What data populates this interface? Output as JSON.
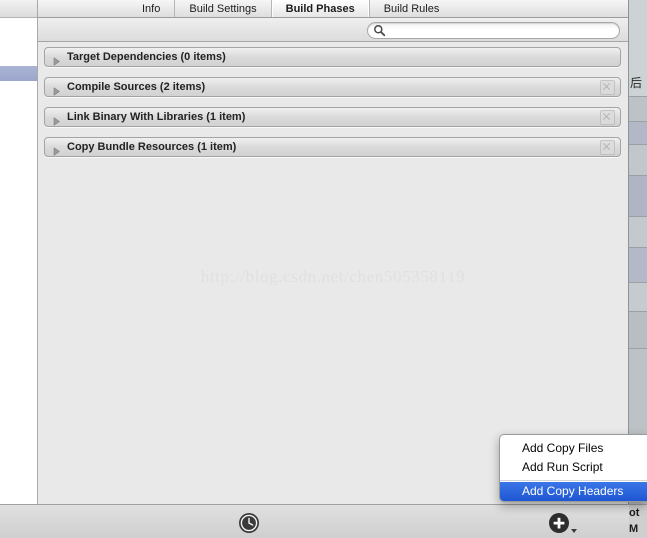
{
  "window": {
    "watermark": "http://blog.csdn.net/chen505358119"
  },
  "tabs": [
    {
      "label": "Info",
      "selected": false
    },
    {
      "label": "Build Settings",
      "selected": false
    },
    {
      "label": "Build Phases",
      "selected": true
    },
    {
      "label": "Build Rules",
      "selected": false
    }
  ],
  "search": {
    "value": "",
    "placeholder": "",
    "icon": "search-icon"
  },
  "phases": [
    {
      "title": "Target Dependencies (0 items)",
      "disclosure": "triangle-right-icon",
      "has_remove": false,
      "remove_icon": "remove-x-icon"
    },
    {
      "title": "Compile Sources (2 items)",
      "disclosure": "triangle-right-icon",
      "has_remove": true,
      "remove_icon": "remove-x-icon"
    },
    {
      "title": "Link Binary With Libraries (1 item)",
      "disclosure": "triangle-right-icon",
      "has_remove": true,
      "remove_icon": "remove-x-icon"
    },
    {
      "title": "Copy Bundle Resources (1 item)",
      "disclosure": "triangle-right-icon",
      "has_remove": true,
      "remove_icon": "remove-x-icon"
    }
  ],
  "context_menu": {
    "items": [
      {
        "label": "Add Copy Files",
        "highlighted": false,
        "separator_after": false
      },
      {
        "label": "Add Run Script",
        "highlighted": false,
        "separator_after": true
      },
      {
        "label": "Add Copy Headers",
        "highlighted": true,
        "separator_after": false
      }
    ],
    "highlight_color": "#2a63da"
  },
  "bottom_bar": {
    "history_icon": "clock-icon",
    "add_icon": "plus-icon",
    "add_caret_icon": "caret-down-icon",
    "right_clipped_text": "ot\nM"
  },
  "right_strip": {
    "clipped_glyph": "后"
  },
  "colors": {
    "selection_blue": "#2a63da",
    "nav_selection": "#9aa6cb",
    "panel_bg": "#e9e9e9",
    "chrome_bg": "#dcdcdc",
    "right_strip": "#b9bfc2"
  }
}
